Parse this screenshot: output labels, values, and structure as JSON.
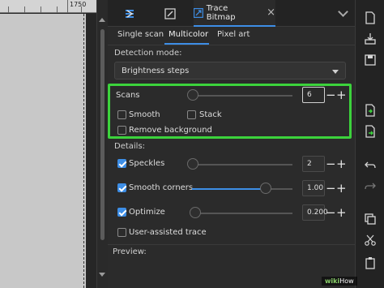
{
  "ruler": {
    "label": "1750"
  },
  "tabs": {
    "fill_stroke_icon": "fill-stroke-icon",
    "xml_editor_icon": "edit-icon",
    "trace_bitmap_label": "Trace Bitmap",
    "trace_bitmap_icon": "trace-bitmap-icon",
    "close": "×"
  },
  "subtabs": [
    "Single scan",
    "Multicolor",
    "Pixel art"
  ],
  "detection": {
    "label": "Detection mode:",
    "selected": "Brightness steps"
  },
  "scans": {
    "label": "Scans",
    "value": "6",
    "slider_fraction": 0.0,
    "smooth_label": "Smooth",
    "smooth_checked": false,
    "stack_label": "Stack",
    "stack_checked": false,
    "remove_bg_label": "Remove background",
    "remove_bg_checked": false
  },
  "details": {
    "label": "Details:",
    "speckles_label": "Speckles",
    "speckles_checked": true,
    "speckles_value": "2",
    "speckles_fraction": 0.0,
    "smooth_corners_label": "Smooth corners",
    "smooth_corners_checked": true,
    "smooth_corners_value": "1.00",
    "smooth_corners_fraction": 0.75,
    "optimize_label": "Optimize",
    "optimize_checked": true,
    "optimize_value": "0.200",
    "optimize_fraction": 0.0,
    "user_assisted_label": "User-assisted trace",
    "user_assisted_checked": false
  },
  "preview": {
    "label": "Preview:"
  },
  "stepper": {
    "minus": "−",
    "plus": "+"
  },
  "toolbar_icons": [
    "new-document-icon",
    "import-icon",
    "save-icon",
    "export-icon",
    "undo-icon",
    "redo-icon",
    "copy-icon",
    "cut-icon",
    "paste-icon",
    "trash-icon"
  ],
  "watermark": {
    "prefix": "wiki",
    "suffix": "How"
  },
  "colors": {
    "accent": "#3d8ee6",
    "highlight": "#3cd33c"
  }
}
